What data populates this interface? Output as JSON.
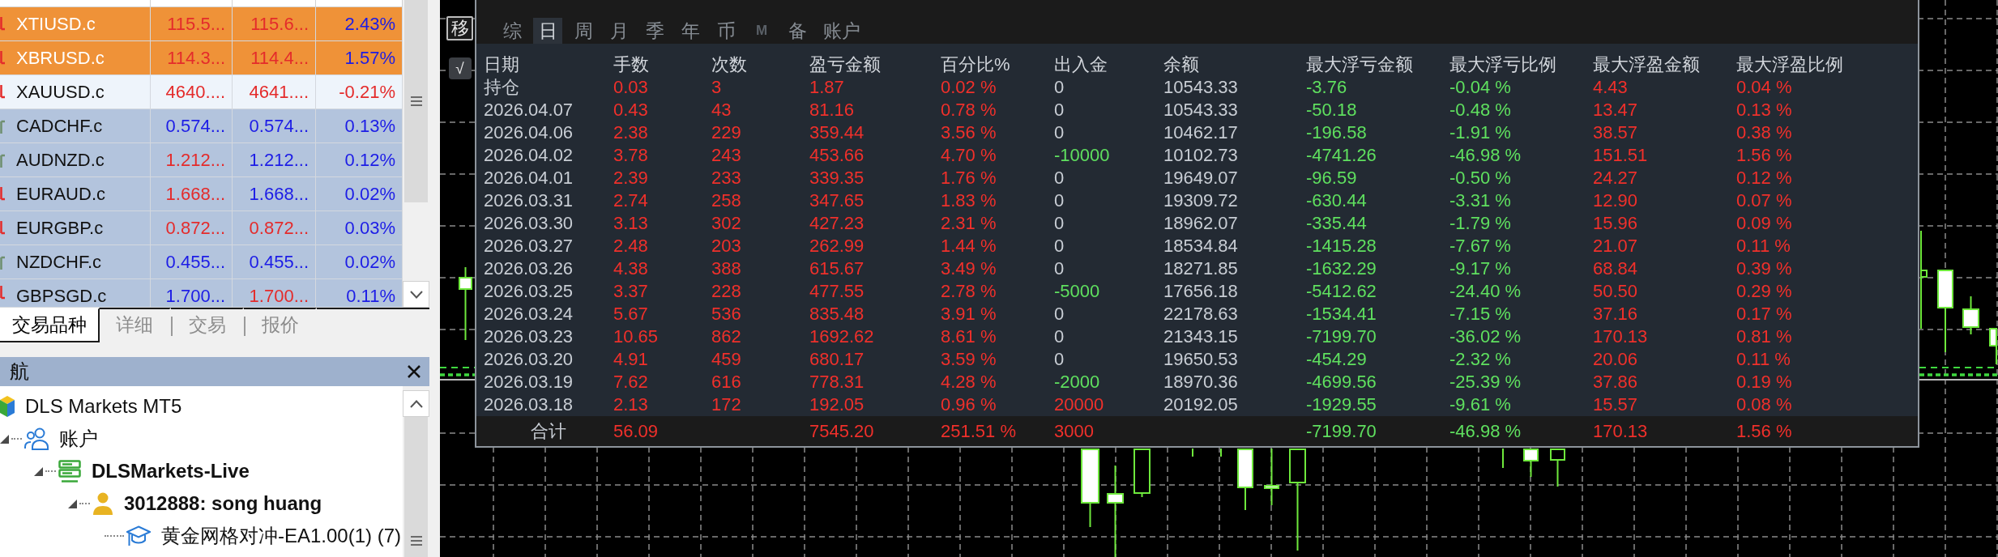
{
  "market_watch": {
    "rows": [
      {
        "symbol": "XTIUSD.c",
        "rising": false,
        "color": "#ef9238",
        "bid": {
          "text": "115.5...",
          "rising": false
        },
        "ask": {
          "text": "115.6...",
          "rising": false
        },
        "change": {
          "text": "2.43%",
          "rising": true
        }
      },
      {
        "symbol": "XBRUSD.c",
        "rising": false,
        "color": "#ef9238",
        "bid": {
          "text": "114.3...",
          "rising": false
        },
        "ask": {
          "text": "114.4...",
          "rising": false
        },
        "change": {
          "text": "1.57%",
          "rising": true
        }
      },
      {
        "symbol": "XAUUSD.c",
        "rising": false,
        "color": "#eef4fb",
        "bid": {
          "text": "4640....",
          "rising": false
        },
        "ask": {
          "text": "4641....",
          "rising": false
        },
        "change": {
          "text": "-0.21%",
          "rising": false
        }
      },
      {
        "symbol": "CADCHF.c",
        "rising": true,
        "color": "#b3c4dd",
        "bid": {
          "text": "0.574...",
          "rising": true
        },
        "ask": {
          "text": "0.574...",
          "rising": true
        },
        "change": {
          "text": "0.13%",
          "rising": true
        }
      },
      {
        "symbol": "AUDNZD.c",
        "rising": true,
        "color": "#b3c4dd",
        "bid": {
          "text": "1.212...",
          "rising": false
        },
        "ask": {
          "text": "1.212...",
          "rising": true
        },
        "change": {
          "text": "0.12%",
          "rising": true
        }
      },
      {
        "symbol": "EURAUD.c",
        "rising": false,
        "color": "#b3c4dd",
        "bid": {
          "text": "1.668...",
          "rising": false
        },
        "ask": {
          "text": "1.668...",
          "rising": true
        },
        "change": {
          "text": "0.02%",
          "rising": true
        }
      },
      {
        "symbol": "EURGBP.c",
        "rising": false,
        "color": "#b3c4dd",
        "bid": {
          "text": "0.872...",
          "rising": false
        },
        "ask": {
          "text": "0.872...",
          "rising": false
        },
        "change": {
          "text": "0.03%",
          "rising": true
        }
      },
      {
        "symbol": "NZDCHF.c",
        "rising": true,
        "color": "#b3c4dd",
        "bid": {
          "text": "0.455...",
          "rising": true
        },
        "ask": {
          "text": "0.455...",
          "rising": true
        },
        "change": {
          "text": "0.02%",
          "rising": true
        }
      },
      {
        "symbol": "GBPSGD.c",
        "rising": false,
        "color": "#b3c4dd",
        "bid": {
          "text": "1.700...",
          "rising": true
        },
        "ask": {
          "text": "1.700...",
          "rising": false
        },
        "change": {
          "text": "0.11%",
          "rising": true
        }
      }
    ],
    "tabs": [
      {
        "label": "交易品种",
        "selected": true
      },
      {
        "label": "详细",
        "selected": false
      },
      {
        "label": "交易",
        "selected": false
      },
      {
        "label": "报价",
        "selected": false
      }
    ]
  },
  "navigator": {
    "title": "航",
    "tree": [
      {
        "label": "DLS Markets MT5",
        "kind": "broker",
        "active": false,
        "children": [
          {
            "label": "账户",
            "kind": "accounts",
            "active": false,
            "expanded": true,
            "children": [
              {
                "label": "DLSMarkets-Live",
                "kind": "server",
                "active": true,
                "expanded": true,
                "children": [
                  {
                    "label": "3012888: song huang",
                    "kind": "account",
                    "active": true,
                    "expanded": true,
                    "children": [
                      {
                        "label": "黄金网格对冲-EA1.00(1) (7)",
                        "kind": "expert",
                        "active": false
                      }
                    ]
                  }
                ]
              }
            ]
          }
        ]
      }
    ]
  },
  "chart": {
    "buttons": [
      {
        "label": "移",
        "kind": "outlined"
      },
      {
        "label": "√",
        "kind": "filled"
      }
    ]
  },
  "stats_panel": {
    "tabs": [
      {
        "label": "综",
        "selected": false,
        "disabled": false
      },
      {
        "label": "日",
        "selected": true,
        "disabled": false
      },
      {
        "label": "周",
        "selected": false,
        "disabled": false
      },
      {
        "label": "月",
        "selected": false,
        "disabled": false
      },
      {
        "label": "季",
        "selected": false,
        "disabled": false
      },
      {
        "label": "年",
        "selected": false,
        "disabled": false
      },
      {
        "label": "币",
        "selected": false,
        "disabled": false
      },
      {
        "label": "M",
        "selected": false,
        "disabled": true
      },
      {
        "label": "备",
        "selected": false,
        "disabled": false
      },
      {
        "label": "账户",
        "selected": false,
        "disabled": false
      }
    ],
    "columns": [
      {
        "label": "日期",
        "kind": "plain"
      },
      {
        "label": "手数",
        "kind": "profit"
      },
      {
        "label": "次数",
        "kind": "profit"
      },
      {
        "label": "盈亏金额",
        "kind": "profit"
      },
      {
        "label": "百分比%",
        "kind": "profit"
      },
      {
        "label": "出入金",
        "kind": "cashflow"
      },
      {
        "label": "余额",
        "kind": "plain"
      },
      {
        "label": "最大浮亏金额",
        "kind": "loss"
      },
      {
        "label": "最大浮亏比例",
        "kind": "loss"
      },
      {
        "label": "最大浮盈金额",
        "kind": "profit"
      },
      {
        "label": "最大浮盈比例",
        "kind": "profit"
      }
    ],
    "rows": [
      {
        "kind": "neutral",
        "cells": [
          "持仓",
          "0.03",
          "3",
          "1.87",
          "0.02 %",
          "0",
          "10543.33",
          "-3.76",
          "-0.04 %",
          "4.43",
          "0.04 %"
        ]
      },
      {
        "kind": "neutral",
        "cells": [
          "2026.04.07",
          "0.43",
          "43",
          "81.16",
          "0.78 %",
          "0",
          "10543.33",
          "-50.18",
          "-0.48 %",
          "13.47",
          "0.13 %"
        ]
      },
      {
        "kind": "neutral",
        "cells": [
          "2026.04.06",
          "2.38",
          "229",
          "359.44",
          "3.56 %",
          "0",
          "10462.17",
          "-196.58",
          "-1.91 %",
          "38.57",
          "0.38 %"
        ]
      },
      {
        "kind": "withdrawal",
        "cells": [
          "2026.04.02",
          "3.78",
          "243",
          "453.66",
          "4.70 %",
          "-10000",
          "10102.73",
          "-4741.26",
          "-46.98 %",
          "151.51",
          "1.56 %"
        ]
      },
      {
        "kind": "neutral",
        "cells": [
          "2026.04.01",
          "2.39",
          "233",
          "339.35",
          "1.76 %",
          "0",
          "19649.07",
          "-96.59",
          "-0.50 %",
          "24.27",
          "0.12 %"
        ]
      },
      {
        "kind": "neutral",
        "cells": [
          "2026.03.31",
          "2.74",
          "258",
          "347.65",
          "1.83 %",
          "0",
          "19309.72",
          "-630.44",
          "-3.31 %",
          "12.90",
          "0.07 %"
        ]
      },
      {
        "kind": "neutral",
        "cells": [
          "2026.03.30",
          "3.13",
          "302",
          "427.23",
          "2.31 %",
          "0",
          "18962.07",
          "-335.44",
          "-1.79 %",
          "15.96",
          "0.09 %"
        ]
      },
      {
        "kind": "neutral",
        "cells": [
          "2026.03.27",
          "2.48",
          "203",
          "262.99",
          "1.44 %",
          "0",
          "18534.84",
          "-1415.28",
          "-7.67 %",
          "21.07",
          "0.11 %"
        ]
      },
      {
        "kind": "neutral",
        "cells": [
          "2026.03.26",
          "4.38",
          "388",
          "615.67",
          "3.49 %",
          "0",
          "18271.85",
          "-1632.29",
          "-9.17 %",
          "68.84",
          "0.39 %"
        ]
      },
      {
        "kind": "withdrawal",
        "cells": [
          "2026.03.25",
          "3.37",
          "228",
          "477.55",
          "2.78 %",
          "-5000",
          "17656.18",
          "-5412.62",
          "-24.40 %",
          "50.50",
          "0.29 %"
        ]
      },
      {
        "kind": "neutral",
        "cells": [
          "2026.03.24",
          "5.67",
          "536",
          "835.48",
          "3.91 %",
          "0",
          "22178.63",
          "-1534.41",
          "-7.15 %",
          "37.16",
          "0.17 %"
        ]
      },
      {
        "kind": "neutral",
        "cells": [
          "2026.03.23",
          "10.65",
          "862",
          "1692.62",
          "8.61 %",
          "0",
          "21343.15",
          "-7199.70",
          "-36.02 %",
          "170.13",
          "0.81 %"
        ]
      },
      {
        "kind": "neutral",
        "cells": [
          "2026.03.20",
          "4.91",
          "459",
          "680.17",
          "3.59 %",
          "0",
          "19650.53",
          "-454.29",
          "-2.32 %",
          "20.06",
          "0.11 %"
        ]
      },
      {
        "kind": "withdrawal",
        "cells": [
          "2026.03.19",
          "7.62",
          "616",
          "778.31",
          "4.28 %",
          "-2000",
          "18970.36",
          "-4699.56",
          "-25.39 %",
          "37.86",
          "0.19 %"
        ]
      },
      {
        "kind": "deposit",
        "cells": [
          "2026.03.18",
          "2.13",
          "172",
          "192.05",
          "0.96 %",
          "20000",
          "20192.05",
          "-1929.55",
          "-9.61 %",
          "15.57",
          "0.08 %"
        ]
      }
    ],
    "total": {
      "kind": "deposit",
      "cells": [
        "合计",
        "56.09",
        null,
        "7545.20",
        "251.51 %",
        "3000",
        null,
        "-7199.70",
        "-46.98 %",
        "170.13",
        "1.56 %"
      ]
    }
  }
}
